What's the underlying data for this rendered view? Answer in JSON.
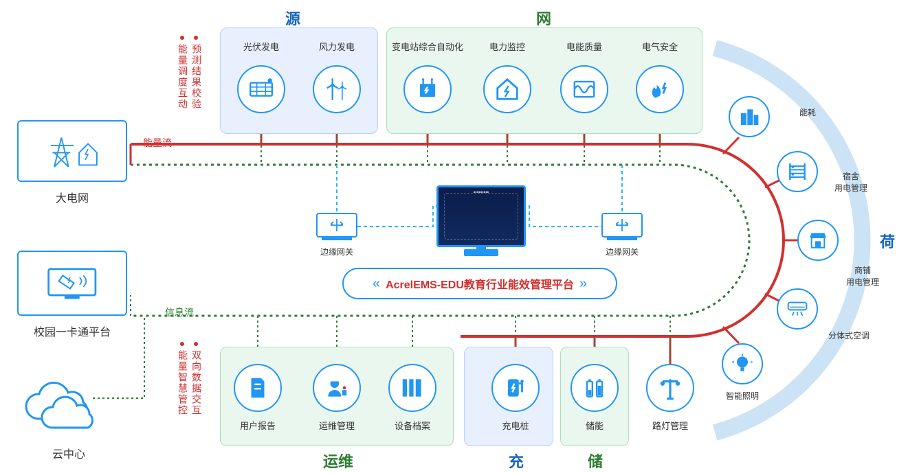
{
  "platform_name": "AcrelEMS-EDU教育行业能效管理平台",
  "groups": {
    "source": {
      "title": "源",
      "nodes": [
        {
          "id": "pv",
          "label": "光伏发电"
        },
        {
          "id": "wind",
          "label": "风力发电"
        }
      ]
    },
    "grid": {
      "title": "网",
      "nodes": [
        {
          "id": "substation",
          "label": "变电站综合自动化"
        },
        {
          "id": "power-monitor",
          "label": "电力监控"
        },
        {
          "id": "power-quality",
          "label": "电能质量"
        },
        {
          "id": "elec-safety",
          "label": "电气安全"
        }
      ]
    },
    "ops": {
      "title": "运维",
      "nodes": [
        {
          "id": "report",
          "label": "用户报告"
        },
        {
          "id": "om",
          "label": "运维管理"
        },
        {
          "id": "asset",
          "label": "设备档案"
        }
      ]
    },
    "charge": {
      "title": "充",
      "nodes": [
        {
          "id": "charger",
          "label": "充电桩"
        }
      ]
    },
    "store": {
      "title": "储",
      "nodes": [
        {
          "id": "battery",
          "label": "储能"
        }
      ]
    },
    "loadPanel": {
      "title": "荷",
      "nodes": [
        {
          "id": "streetlight",
          "label": "路灯管理"
        },
        {
          "id": "lighting",
          "label": "智能照明"
        },
        {
          "id": "ac",
          "label": "分体式空调"
        },
        {
          "id": "shop",
          "label": "商铺\n用电管理"
        },
        {
          "id": "dorm",
          "label": "宿舍\n用电管理"
        },
        {
          "id": "energy",
          "label": "能耗"
        }
      ]
    }
  },
  "external": {
    "maingrid": "大电网",
    "campus_card": "校园一卡通平台",
    "cloud": "云中心"
  },
  "gateways": {
    "label": "边缘网关"
  },
  "flows": {
    "energy": "能量流",
    "info": "信息流"
  },
  "vertical_labels": {
    "top1": "预测结果校验",
    "top2": "能量调度互动",
    "bot1": "双向数据交互",
    "bot2": "能量智慧管控"
  },
  "colors": {
    "blue": "#2196f3",
    "red": "#d32f2f",
    "green": "#2e7d32"
  }
}
